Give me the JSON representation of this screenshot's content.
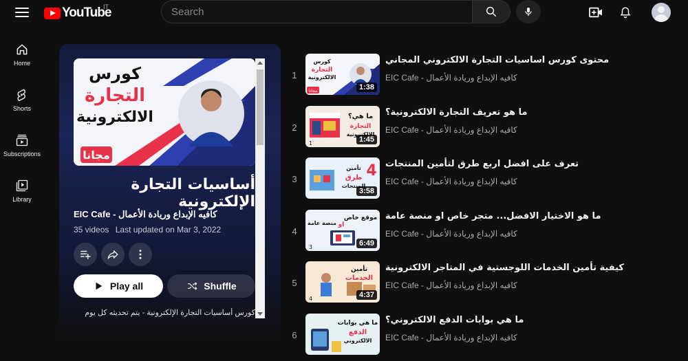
{
  "header": {
    "logo_text": "YouTube",
    "region": "IT",
    "search_placeholder": "Search"
  },
  "sidenav": [
    {
      "label": "Home",
      "icon": "home-icon"
    },
    {
      "label": "Shorts",
      "icon": "shorts-icon"
    },
    {
      "label": "Subscriptions",
      "icon": "subscriptions-icon"
    },
    {
      "label": "Library",
      "icon": "library-icon"
    }
  ],
  "playlist": {
    "thumb_text_line1": "كورس",
    "thumb_text_line2": "التجارة",
    "thumb_text_line3": "الالكترونية",
    "thumb_badge": "مجانا",
    "title": "أساسيات التجارة الإلكترونية",
    "channel": "EIC Cafe - كافيه الإبداع وريادة الأعمال",
    "video_count": "35 videos",
    "last_updated": "Last updated on Mar 3, 2022",
    "play_all_label": "Play all",
    "shuffle_label": "Shuffle",
    "description": "كورس أساسيات التجارة الإلكترونية - يتم تحديثه كل يوم"
  },
  "videos": [
    {
      "index": "1",
      "title": "محتوى كورس اساسيات التجارة الالكتروني المجاني",
      "channel": "EIC Cafe - كافيه الإبداع وريادة الأعمال",
      "duration": "1:38",
      "thumb_text": "كورس التجارة الالكترونية"
    },
    {
      "index": "2",
      "title": "ما هو تعريف التجارة الالكترونية؟",
      "channel": "EIC Cafe - كافيه الإبداع وريادة الأعمال",
      "duration": "1:45",
      "thumb_text": "ما هي؟ التجارة الالكترونية"
    },
    {
      "index": "3",
      "title": "تعرف على افضل اربع طرق لتأمين المنتجات",
      "channel": "EIC Cafe - كافيه الإبداع وريادة الأعمال",
      "duration": "3:58",
      "thumb_text": "4 طرق لتأمين المنتجات"
    },
    {
      "index": "4",
      "title": "ما هو الاختيار الافضل... متجر خاص او منصة عامة",
      "channel": "EIC Cafe - كافيه الإبداع وريادة الأعمال",
      "duration": "6:49",
      "thumb_text": "موقع خاص او منصة عامة"
    },
    {
      "index": "5",
      "title": "كيفية تأمين الخدمات اللوجستية في المتاجر الالكترونية",
      "channel": "EIC Cafe - كافيه الإبداع وريادة الأعمال",
      "duration": "4:37",
      "thumb_text": "تأمين الخدمات اللوجستية"
    },
    {
      "index": "6",
      "title": "ما هي بوابات الدفع الالكتروني؟",
      "channel": "EIC Cafe - كافيه الإبداع وريادة الأعمال",
      "duration": "",
      "thumb_text": "ما هي بوابات الدفع الالكتروني"
    }
  ]
}
